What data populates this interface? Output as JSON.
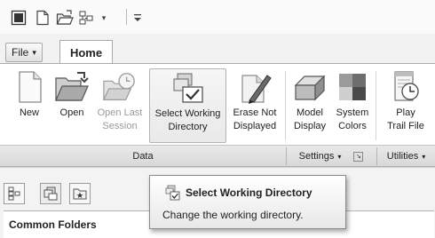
{
  "qat": {
    "icons": [
      "window-icon",
      "new-icon",
      "open-icon",
      "tree-icon",
      "chevron-down-icon",
      "customize-icon"
    ]
  },
  "tabs": {
    "file_label": "File",
    "home_label": "Home"
  },
  "ribbon": {
    "buttons": [
      {
        "label1": "New",
        "label2": "",
        "icon": "new-doc-icon"
      },
      {
        "label1": "Open",
        "label2": "",
        "icon": "folder-icon"
      },
      {
        "label1": "Open Last",
        "label2": "Session",
        "icon": "folder-clock-icon",
        "disabled": true
      },
      {
        "label1": "Select Working",
        "label2": "Directory",
        "icon": "select-directory-icon"
      },
      {
        "label1": "Erase Not",
        "label2": "Displayed",
        "icon": "eraser-icon"
      },
      {
        "label1": "Model",
        "label2": "Display",
        "icon": "model-box-icon"
      },
      {
        "label1": "System",
        "label2": "Colors",
        "icon": "color-palette-icon"
      },
      {
        "label1": "Play",
        "label2": "Trail File",
        "icon": "trail-file-icon"
      }
    ],
    "groups": {
      "data": "Data",
      "settings": "Settings",
      "utilities": "Utilities"
    }
  },
  "navigator": {
    "common_folders": "Common Folders"
  },
  "tooltip": {
    "title": "Select Working Directory",
    "description": "Change the working directory."
  }
}
